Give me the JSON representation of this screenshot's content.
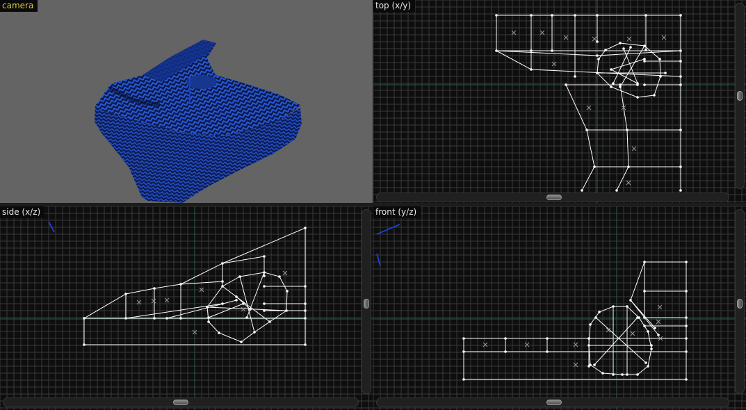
{
  "viewports": {
    "camera": {
      "label": "camera"
    },
    "top": {
      "label": "top (x/y)"
    },
    "side": {
      "label": "side (x/z)"
    },
    "front": {
      "label": "front (y/z)"
    }
  },
  "colors": {
    "camera_label": "#d8c84a",
    "ortho_label": "#e8e8e8",
    "viewport_bg": "#0e0e0e",
    "camera_bg": "#646464",
    "grid_line": "#3a3a3a",
    "axis_line": "#2c5a4e",
    "wire": "#ffffff",
    "mesh_blue": "#1d3f9e",
    "gizmo": "#1a3fd0"
  }
}
